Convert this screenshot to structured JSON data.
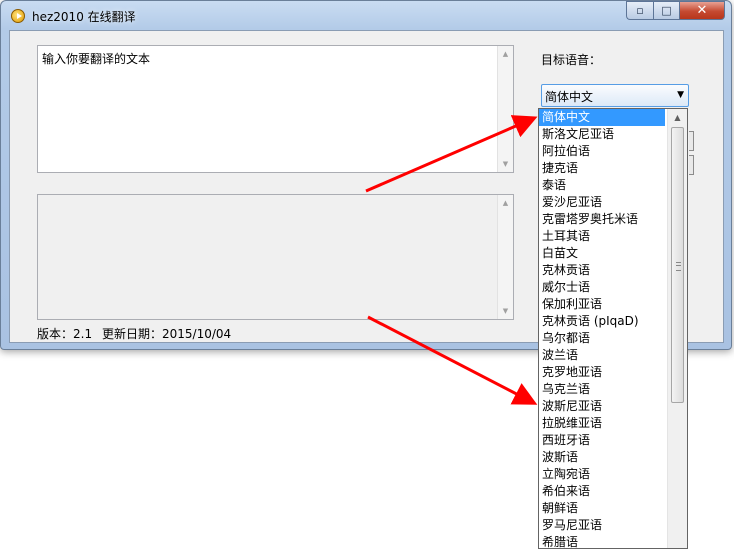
{
  "window": {
    "title": "hez2010 在线翻译",
    "minimize_glyph": "▭",
    "maximize_glyph": "□",
    "close_glyph": "✕"
  },
  "input": {
    "value": "输入你要翻译的文本"
  },
  "output": {
    "value": ""
  },
  "target_language": {
    "label": "目标语音：",
    "selected": "简体中文",
    "options": [
      "简体中文",
      "斯洛文尼亚语",
      "阿拉伯语",
      "捷克语",
      "泰语",
      "爱沙尼亚语",
      "克雷塔罗奥托米语",
      "土耳其语",
      "白苗文",
      "克林贡语",
      "威尔士语",
      "保加利亚语",
      "克林贡语 (pIqaD)",
      "乌尔都语",
      "波兰语",
      "克罗地亚语",
      "乌克兰语",
      "波斯尼亚语",
      "拉脱维亚语",
      "西班牙语",
      "波斯语",
      "立陶宛语",
      "希伯来语",
      "朝鲜语",
      "罗马尼亚语",
      "希腊语"
    ]
  },
  "footer": {
    "version": "版本：2.1",
    "update_date": "更新日期：2015/10/04"
  },
  "colors": {
    "selection": "#3399ff",
    "arrow": "#ff0000",
    "title_bar": "#b3cbe8"
  },
  "icons": {
    "app": "app-logo-icon",
    "scroll_up": "scroll-up-arrow-icon",
    "scroll_down": "scroll-down-arrow-icon",
    "dropdown": "chevron-down-icon"
  }
}
